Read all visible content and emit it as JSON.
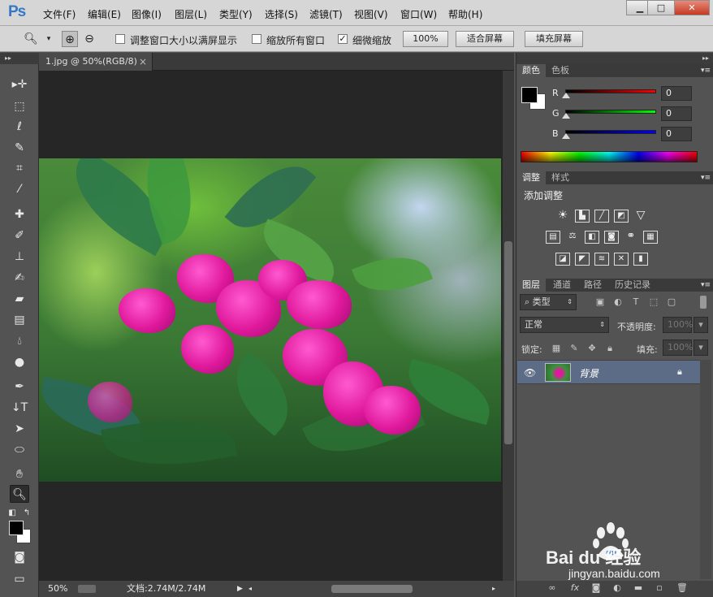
{
  "app": {
    "logo": "Ps"
  },
  "menu": [
    "文件(F)",
    "编辑(E)",
    "图像(I)",
    "图层(L)",
    "类型(Y)",
    "选择(S)",
    "滤镜(T)",
    "视图(V)",
    "窗口(W)",
    "帮助(H)"
  ],
  "options": {
    "resize_windows": "调整窗口大小以满屏显示",
    "zoom_all": "缩放所有窗口",
    "scrubby_zoom": "细微缩放",
    "pct_btn": "100%",
    "fit_btn": "适合屏幕",
    "fill_btn": "填充屏幕"
  },
  "doc": {
    "tab": "1.jpg @ 50%(RGB/8)"
  },
  "status": {
    "zoom": "50%",
    "info": "文档:2.74M/2.74M"
  },
  "color_panel": {
    "tabs": [
      "颜色",
      "色板"
    ],
    "channels": [
      {
        "label": "R",
        "value": "0",
        "color": "#ff0000"
      },
      {
        "label": "G",
        "value": "0",
        "color": "#00ff00"
      },
      {
        "label": "B",
        "value": "0",
        "color": "#0000ff"
      }
    ]
  },
  "adjust_panel": {
    "tabs": [
      "调整",
      "样式"
    ],
    "title": "添加调整"
  },
  "layers_panel": {
    "tabs": [
      "图层",
      "通道",
      "路径",
      "历史记录"
    ],
    "filter": "类型",
    "blend_mode": "正常",
    "opacity_label": "不透明度:",
    "opacity": "100%",
    "lock_label": "锁定:",
    "fill_label": "填充:",
    "fill": "100%",
    "layer_name": "背景"
  },
  "watermark": {
    "brand": "Bai du 经验",
    "url": "jingyan.baidu.com"
  }
}
